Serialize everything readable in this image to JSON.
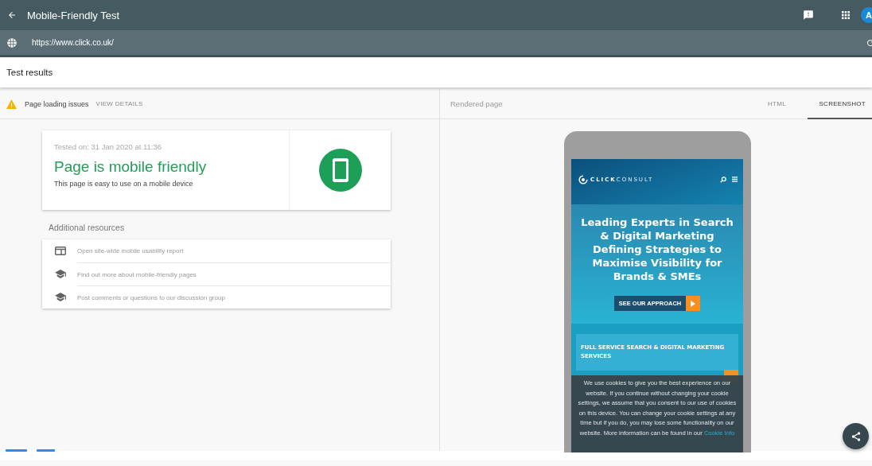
{
  "app_bar": {
    "title": "Mobile-Friendly Test",
    "avatar_letter": "A"
  },
  "url_bar": {
    "url": "https://www.click.co.uk/"
  },
  "results_header": {
    "title": "Test results"
  },
  "left_panel": {
    "issue": {
      "label": "Page loading issues",
      "action": "VIEW DETAILS"
    },
    "result_card": {
      "tested_on": "Tested on: 31 Jan 2020 at 11:36",
      "verdict": "Page is mobile friendly",
      "description": "This page is easy to use on a mobile device"
    },
    "resources_title": "Additional resources",
    "resources": [
      {
        "kind": "report",
        "label": "Open site-wide mobile usability report"
      },
      {
        "kind": "learn",
        "label": "Find out more about mobile-friendly pages"
      },
      {
        "kind": "learn",
        "label": "Post comments or questions to our discussion group"
      }
    ]
  },
  "right_panel": {
    "title": "Rendered page",
    "tabs": [
      {
        "label": "HTML",
        "selected": false
      },
      {
        "label": "SCREENSHOT",
        "selected": true
      }
    ],
    "phone_screenshot": {
      "logo_bold": "CLICK",
      "logo_light": "CONSULT",
      "headline": "Leading Experts in Search & Digital Marketing Defining Strategies to Maximise Visibility for Brands & SMEs",
      "cta": "SEE OUR APPROACH",
      "services_title": "FULL SERVICE SEARCH & DIGITAL MARKETING SERVICES",
      "cookie_notice": {
        "text": "We use cookies to give you the best experience on our website. If you continue without changing your cookie settings, we assume that you consent to our use of cookies on this device. You can change your cookie settings at any time but if you do, you may lose some functionality on our website. More information can be found in our ",
        "link": "Cookie Info"
      }
    }
  }
}
